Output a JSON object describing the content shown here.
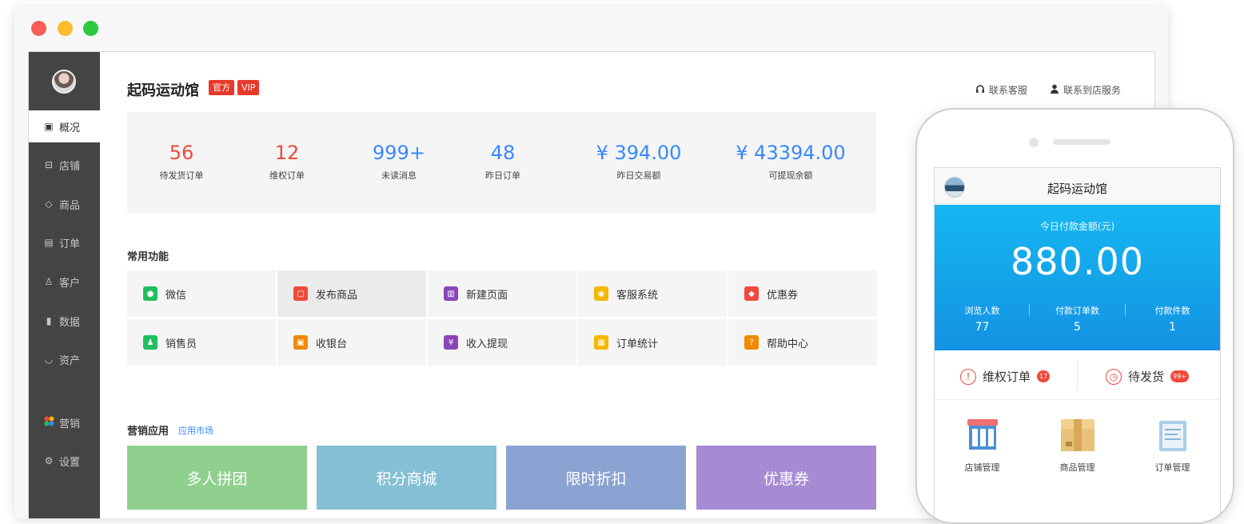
{
  "window": {
    "shop_name": "起码运动馆",
    "badges": [
      "官方",
      "VIP"
    ],
    "top_links": [
      {
        "label": "联系客服",
        "icon": "headset-icon"
      },
      {
        "label": "联系到店服务",
        "icon": "user-icon"
      }
    ]
  },
  "sidebar": {
    "items": [
      {
        "label": "概况",
        "icon": "overview-icon",
        "active": true
      },
      {
        "label": "店铺",
        "icon": "store-icon"
      },
      {
        "label": "商品",
        "icon": "tag-icon"
      },
      {
        "label": "订单",
        "icon": "order-list-icon"
      },
      {
        "label": "客户",
        "icon": "customer-icon"
      },
      {
        "label": "数据",
        "icon": "bar-chart-icon"
      },
      {
        "label": "资产",
        "icon": "wallet-icon"
      },
      {
        "label": "营销",
        "icon": "marketing-icon"
      },
      {
        "label": "设置",
        "icon": "settings-gear-icon"
      }
    ]
  },
  "stats": [
    {
      "value": "56",
      "label": "待发货订单",
      "color": "#f04a3a"
    },
    {
      "value": "12",
      "label": "维权订单",
      "color": "#f04a3a"
    },
    {
      "value": "999+",
      "label": "未读消息",
      "color": "#3888ff"
    },
    {
      "value": "48",
      "label": "昨日订单",
      "color": "#3888ff"
    },
    {
      "value": "¥ 394.00",
      "label": "昨日交易额",
      "color": "#3888ff"
    },
    {
      "value": "¥ 43394.00",
      "label": "可提现余额",
      "color": "#3888ff"
    }
  ],
  "common": {
    "title": "常用功能",
    "items": [
      {
        "label": "微信",
        "icon": "wechat-icon",
        "color": "#1fbf5f"
      },
      {
        "label": "发布商品",
        "icon": "publish-product-icon",
        "color": "#f04a3a"
      },
      {
        "label": "新建页面",
        "icon": "new-page-icon",
        "color": "#8a46b8"
      },
      {
        "label": "客服系统",
        "icon": "customer-service-icon",
        "color": "#f5b700"
      },
      {
        "label": "优惠券",
        "icon": "coupon-icon",
        "color": "#f04a3a"
      },
      {
        "label": "销售员",
        "icon": "salesperson-icon",
        "color": "#1fbf5f"
      },
      {
        "label": "收银台",
        "icon": "cashier-icon",
        "color": "#f08a00"
      },
      {
        "label": "收入提现",
        "icon": "withdraw-icon",
        "color": "#8a46b8"
      },
      {
        "label": "订单统计",
        "icon": "order-stats-icon",
        "color": "#f5b700"
      },
      {
        "label": "帮助中心",
        "icon": "help-icon",
        "color": "#f08a00"
      }
    ]
  },
  "marketing": {
    "title": "营销应用",
    "link": "应用市场",
    "tiles": [
      {
        "label": "多人拼团",
        "color": "#8fd08e"
      },
      {
        "label": "积分商城",
        "color": "#85bfd3"
      },
      {
        "label": "限时折扣",
        "color": "#8aa3d2"
      },
      {
        "label": "优惠券",
        "color": "#a68ad4"
      }
    ]
  },
  "phone": {
    "title": "起码运动馆",
    "today_label": "今日付款金额(元)",
    "today_amount": "880.00",
    "metrics": [
      {
        "label": "浏览人数",
        "value": "77"
      },
      {
        "label": "付款订单数",
        "value": "5"
      },
      {
        "label": "付款件数",
        "value": "1"
      }
    ],
    "tabs": [
      {
        "label": "维权订单",
        "count": "17",
        "icon": "alert-circle-icon"
      },
      {
        "label": "待发货",
        "count": "99+",
        "icon": "clock-icon"
      }
    ],
    "grid": [
      {
        "label": "店铺管理",
        "icon": "storefront-icon"
      },
      {
        "label": "商品管理",
        "icon": "product-box-icon"
      },
      {
        "label": "订单管理",
        "icon": "clipboard-icon"
      }
    ]
  }
}
